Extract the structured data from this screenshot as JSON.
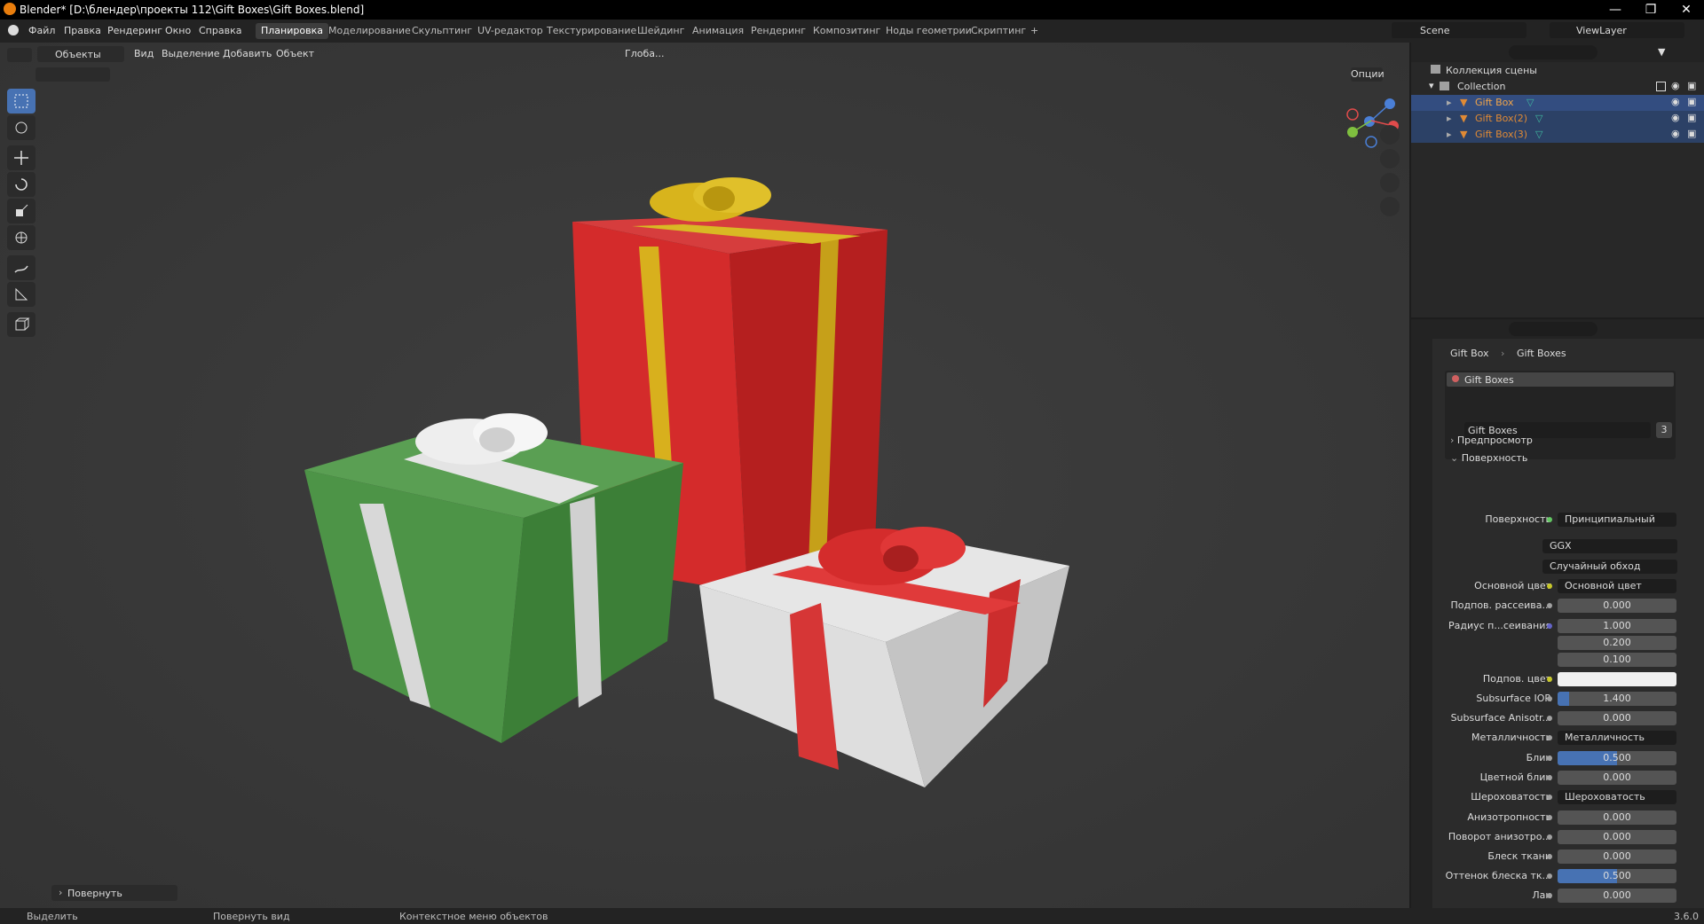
{
  "window": {
    "title": "Blender* [D:\\блендер\\проекты 112\\Gift Boxes\\Gift Boxes.blend]",
    "controls": [
      "minimize",
      "maximize",
      "close"
    ]
  },
  "menu": {
    "items": [
      "Файл",
      "Правка",
      "Рендеринг",
      "Окно",
      "Справка"
    ],
    "workspaces": [
      "Планировка",
      "Моделирование",
      "Скульптинг",
      "UV-редактор",
      "Текстурирование",
      "Шейдинг",
      "Анимация",
      "Рендеринг",
      "Композитинг",
      "Ноды геометрии",
      "Скриптинг"
    ],
    "active_workspace": "Планировка",
    "add_tab": "+",
    "scene": "Scene",
    "view_layer": "ViewLayer"
  },
  "viewport_header": {
    "mode": "Объекты",
    "menus": [
      "Вид",
      "Выделение",
      "Добавить",
      "Объект"
    ],
    "orientation": "Глоба...",
    "options": "Опции"
  },
  "viewport": {
    "last_operator": "Повернуть",
    "gizmo_axes": [
      "X",
      "Y",
      "Z"
    ]
  },
  "outliner": {
    "scene_collection": "Коллекция сцены",
    "collection": "Collection",
    "objects": [
      {
        "name": "Gift Box",
        "selected": true,
        "active": true
      },
      {
        "name": "Gift Box(2)",
        "selected": true,
        "active": false
      },
      {
        "name": "Gift Box(3)",
        "selected": true,
        "active": false
      }
    ]
  },
  "properties": {
    "breadcrumb": [
      "Gift Box",
      "Gift Boxes"
    ],
    "material_slots": [
      "Gift Boxes"
    ],
    "material_name": "Gift Boxes",
    "users": "3",
    "panels": {
      "preview": "Предпросмотр",
      "surface": "Поверхность"
    },
    "rows": [
      {
        "label": "Поверхность",
        "value": "Принципиальный BSDF",
        "kind": "link",
        "dot": "green"
      },
      {
        "label": "",
        "value": "GGX",
        "kind": "dropdown"
      },
      {
        "label": "",
        "value": "Случайный обход",
        "kind": "dropdown"
      },
      {
        "label": "Основной цвет",
        "value": "Основной цвет",
        "kind": "link",
        "dot": "yellow"
      },
      {
        "label": "Подпов. рассеива...",
        "value": "0.000",
        "kind": "number"
      },
      {
        "label": "Радиус п...сеивания",
        "value": "1.000",
        "kind": "number",
        "dot": "blue"
      },
      {
        "label": "",
        "value": "0.200",
        "kind": "number",
        "dot": "none"
      },
      {
        "label": "",
        "value": "0.100",
        "kind": "number",
        "dot": "none"
      },
      {
        "label": "Подпов. цвет",
        "value": "",
        "kind": "color",
        "dot": "yellow"
      },
      {
        "label": "Subsurface IOR",
        "value": "1.400",
        "kind": "number",
        "fill": 0.1
      },
      {
        "label": "Subsurface Anisotr...",
        "value": "0.000",
        "kind": "number"
      },
      {
        "label": "Металличность",
        "value": "Металличность",
        "kind": "link"
      },
      {
        "label": "Блик",
        "value": "0.500",
        "kind": "number",
        "fill": 0.5
      },
      {
        "label": "Цветной блик",
        "value": "0.000",
        "kind": "number"
      },
      {
        "label": "Шероховатость",
        "value": "Шероховатость",
        "kind": "link"
      },
      {
        "label": "Анизотропность",
        "value": "0.000",
        "kind": "number"
      },
      {
        "label": "Поворот анизотро...",
        "value": "0.000",
        "kind": "number"
      },
      {
        "label": "Блеск ткани",
        "value": "0.000",
        "kind": "number"
      },
      {
        "label": "Оттенок блеска тк...",
        "value": "0.500",
        "kind": "number",
        "fill": 0.5
      },
      {
        "label": "Лак",
        "value": "0.000",
        "kind": "number"
      }
    ]
  },
  "statusbar": {
    "items": [
      "Выделить",
      "Повернуть вид",
      "Контекстное меню объектов"
    ],
    "version": "3.6.0"
  },
  "colors": {
    "accent": "#4772b3",
    "selected_row": "#334d80",
    "object_orange": "#e08a35",
    "mesh_green": "#3fb9a0"
  }
}
